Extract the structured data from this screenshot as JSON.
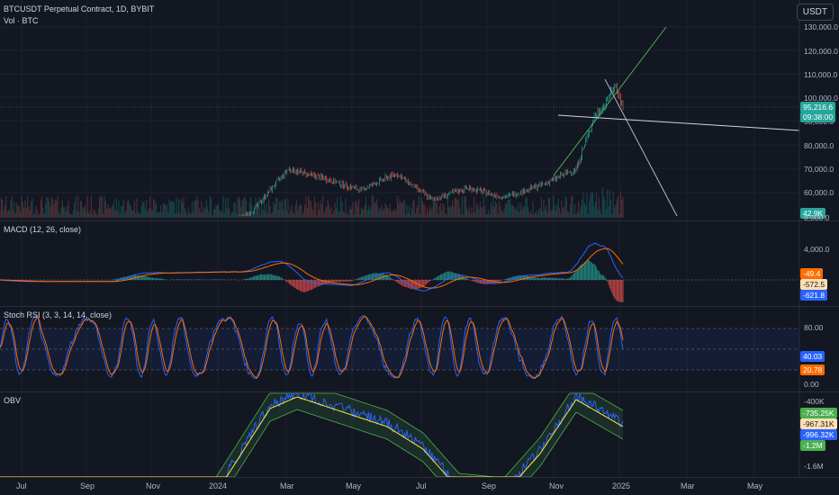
{
  "header": {
    "title": "BTCUSDT Perpetual Contract, 1D, BYBIT",
    "volume_label": "Vol · BTC",
    "currency": "USDT"
  },
  "price_axis": {
    "ticks": [
      "130,000.0",
      "120,000.0",
      "110,000.0",
      "100,000.0",
      "90,000.0",
      "80,000.0",
      "70,000.0",
      "60,000.0"
    ],
    "last_price": "95,216.6",
    "countdown": "09:38:00",
    "volume_last": "42.9K",
    "colors": {
      "up": "#26a69a",
      "down": "#ef5350",
      "last_price_bg": "#26a69a"
    }
  },
  "macd": {
    "title": "MACD (12, 26, close)",
    "ticks": [
      "8,000.0",
      "4,000.0"
    ],
    "values": {
      "histogram": "-49.4",
      "macd": "-572.5",
      "signal": "-621.8"
    },
    "colors": {
      "macd": "#2962ff",
      "signal": "#ff6d00",
      "histogram_up": "#26a69a",
      "histogram_down": "#ef5350"
    }
  },
  "stoch_rsi": {
    "title": "Stoch RSI (3, 3, 14, 14, close)",
    "ticks": [
      "80.00",
      "0.00"
    ],
    "values": {
      "k": "40.03",
      "d": "20.78"
    },
    "colors": {
      "k": "#2962ff",
      "d": "#ff6d00",
      "band": "#2962ff"
    }
  },
  "obv": {
    "title": "OBV",
    "ticks": [
      "-400K",
      "-1.6M"
    ],
    "values": {
      "a": "-735.25K",
      "b": "-967.31K",
      "c": "-996.32K",
      "d": "-1.2M"
    },
    "colors": {
      "obv": "#2962ff",
      "ma": "#ffeb3b",
      "band": "#4caf50"
    }
  },
  "time_axis": {
    "labels": [
      "Jul",
      "Sep",
      "Nov",
      "2024",
      "Mar",
      "May",
      "Jul",
      "Sep",
      "Nov",
      "2025",
      "Mar",
      "May"
    ]
  },
  "chart_data": {
    "type": "line",
    "x": [
      "2023-07",
      "2023-09",
      "2023-11",
      "2024-01",
      "2024-03",
      "2024-05",
      "2024-07",
      "2024-09",
      "2024-11",
      "2025-01",
      "2025-03",
      "2025-05"
    ],
    "series": [
      {
        "values": [
          null,
          null,
          null,
          null,
          68000,
          66000,
          62000,
          59000,
          70000,
          95216.6,
          null,
          null
        ]
      }
    ],
    "ylim": [
      50000,
      132000
    ],
    "annotations": [
      "trendline up",
      "trendline down",
      "horizontal trendline"
    ]
  }
}
